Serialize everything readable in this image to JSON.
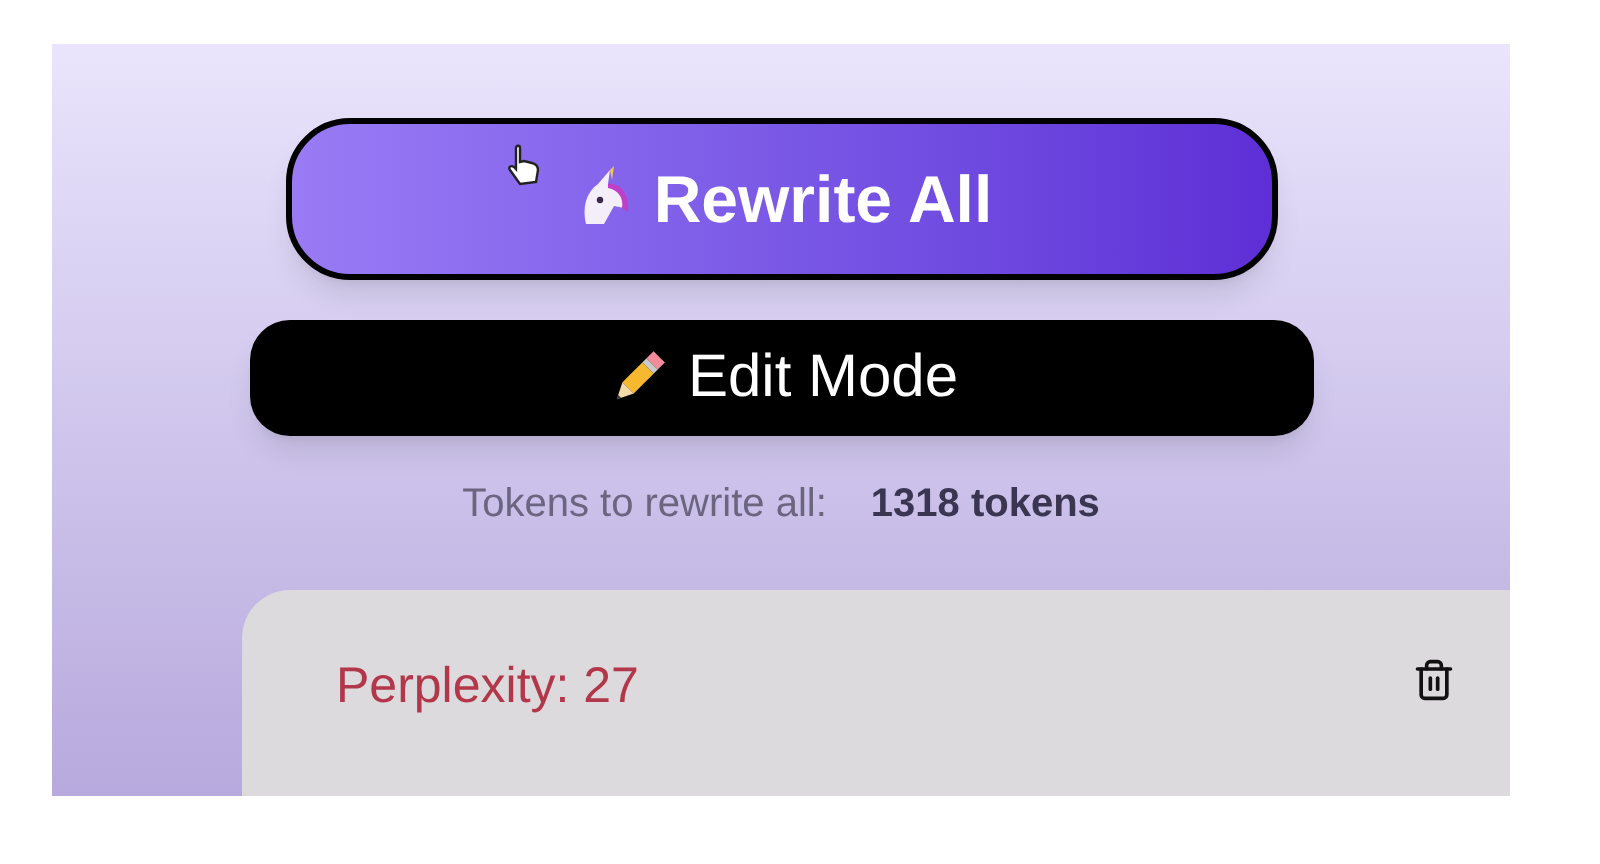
{
  "rewrite_button": {
    "label": "Rewrite All"
  },
  "edit_button": {
    "label": "Edit Mode"
  },
  "tokens": {
    "label": "Tokens to rewrite all:",
    "value": "1318 tokens"
  },
  "card": {
    "title": "Perplexity: 27"
  }
}
